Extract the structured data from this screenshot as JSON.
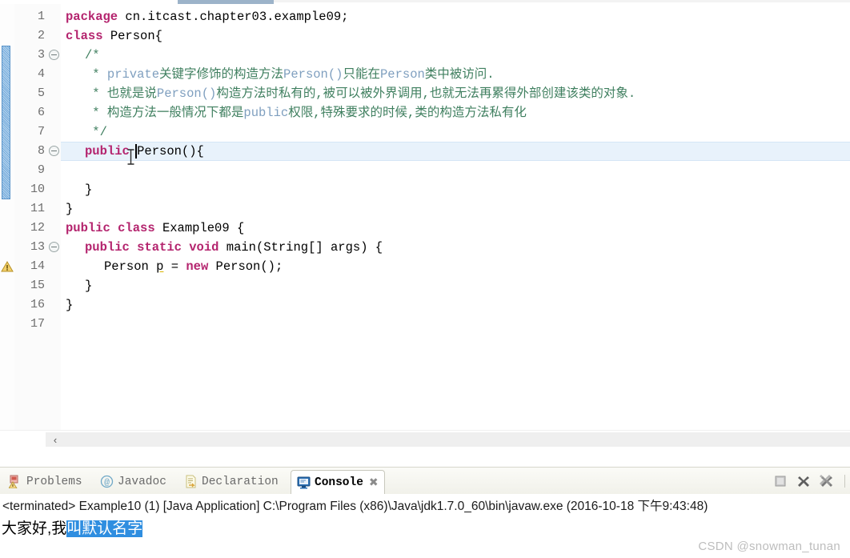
{
  "app": {
    "name": "Eclipse IDE",
    "watermark": "CSDN @snowman_tunan"
  },
  "editor": {
    "font": "monospace",
    "current_line": 8,
    "caret_line": 8,
    "caret_column": 16,
    "changed_lines_from": 3,
    "changed_lines_to": 10,
    "warning_line": 14,
    "folding_lines": [
      3,
      8,
      13
    ],
    "line_numbers": [
      "1",
      "2",
      "3",
      "4",
      "5",
      "6",
      "7",
      "8",
      "9",
      "10",
      "11",
      "12",
      "13",
      "14",
      "15",
      "16",
      "17"
    ],
    "lines": [
      {
        "n": "1",
        "indent": 0,
        "segments": [
          {
            "t": "kw",
            "s": "package"
          },
          {
            "t": "plain",
            "s": " cn.itcast.chapter03.example09;"
          }
        ]
      },
      {
        "n": "2",
        "indent": 0,
        "segments": [
          {
            "t": "kw",
            "s": "class"
          },
          {
            "t": "plain",
            "s": " Person{"
          }
        ]
      },
      {
        "n": "3",
        "indent": 1,
        "segments": [
          {
            "t": "cmt",
            "s": "/*"
          }
        ]
      },
      {
        "n": "4",
        "indent": 1,
        "segments": [
          {
            "t": "cmt",
            "s": " * "
          },
          {
            "t": "cmt-kw",
            "s": "private"
          },
          {
            "t": "cmt",
            "s": "关键字修饰的构造方法"
          },
          {
            "t": "cmt-kw",
            "s": "Person()"
          },
          {
            "t": "cmt",
            "s": "只能在"
          },
          {
            "t": "cmt-kw",
            "s": "Person"
          },
          {
            "t": "cmt",
            "s": "类中被访问."
          }
        ]
      },
      {
        "n": "5",
        "indent": 1,
        "segments": [
          {
            "t": "cmt",
            "s": " * 也就是说"
          },
          {
            "t": "cmt-kw",
            "s": "Person()"
          },
          {
            "t": "cmt",
            "s": "构造方法时私有的,被可以被外界调用,也就无法再累得外部创建该类的对象."
          }
        ]
      },
      {
        "n": "6",
        "indent": 1,
        "segments": [
          {
            "t": "cmt",
            "s": " * 构造方法一般情况下都是"
          },
          {
            "t": "cmt-kw",
            "s": "public"
          },
          {
            "t": "cmt",
            "s": "权限,特殊要求的时候,类的构造方法私有化"
          }
        ]
      },
      {
        "n": "7",
        "indent": 1,
        "segments": [
          {
            "t": "cmt",
            "s": " */"
          }
        ]
      },
      {
        "n": "8",
        "indent": 1,
        "segments": [
          {
            "t": "kw",
            "s": "public"
          },
          {
            "t": "plain",
            "s": " Person(){"
          }
        ]
      },
      {
        "n": "9",
        "indent": 1,
        "segments": [
          {
            "t": "plain",
            "s": ""
          }
        ]
      },
      {
        "n": "10",
        "indent": 1,
        "segments": [
          {
            "t": "plain",
            "s": "}"
          }
        ]
      },
      {
        "n": "11",
        "indent": 0,
        "segments": [
          {
            "t": "plain",
            "s": "}"
          }
        ]
      },
      {
        "n": "12",
        "indent": 0,
        "segments": [
          {
            "t": "kw",
            "s": "public"
          },
          {
            "t": "plain",
            "s": " "
          },
          {
            "t": "kw",
            "s": "class"
          },
          {
            "t": "plain",
            "s": " Example09 {"
          }
        ]
      },
      {
        "n": "13",
        "indent": 1,
        "segments": [
          {
            "t": "kw",
            "s": "public"
          },
          {
            "t": "plain",
            "s": " "
          },
          {
            "t": "kw",
            "s": "static"
          },
          {
            "t": "plain",
            "s": " "
          },
          {
            "t": "kw",
            "s": "void"
          },
          {
            "t": "plain",
            "s": " main(String[] args) {"
          }
        ]
      },
      {
        "n": "14",
        "indent": 2,
        "segments": [
          {
            "t": "plain",
            "s": "Person "
          },
          {
            "t": "warn",
            "s": "p"
          },
          {
            "t": "plain",
            "s": " = "
          },
          {
            "t": "kw",
            "s": "new"
          },
          {
            "t": "plain",
            "s": " Person();"
          }
        ]
      },
      {
        "n": "15",
        "indent": 1,
        "segments": [
          {
            "t": "plain",
            "s": "}"
          }
        ]
      },
      {
        "n": "16",
        "indent": 0,
        "segments": [
          {
            "t": "plain",
            "s": "}"
          }
        ]
      },
      {
        "n": "17",
        "indent": 0,
        "segments": [
          {
            "t": "plain",
            "s": ""
          }
        ]
      }
    ]
  },
  "scrollbar": {
    "left_arrow": "‹"
  },
  "bottom_view": {
    "tabs": [
      {
        "label": "Problems",
        "icon": "problems-icon",
        "active": false,
        "closable": false
      },
      {
        "label": "Javadoc",
        "icon": "javadoc-icon",
        "active": false,
        "closable": false
      },
      {
        "label": "Declaration",
        "icon": "declaration-icon",
        "active": false,
        "closable": false
      },
      {
        "label": "Console",
        "icon": "console-icon",
        "active": true,
        "closable": true,
        "close_glyph": "✖"
      }
    ],
    "tools": [
      {
        "name": "terminate-button",
        "title": "Terminate"
      },
      {
        "name": "remove-launch-button",
        "title": "Remove Launch"
      },
      {
        "name": "remove-all-terminated-button",
        "title": "Remove All Terminated Launches"
      }
    ],
    "console": {
      "header": "<terminated> Example10 (1) [Java Application] C:\\Program Files (x86)\\Java\\jdk1.7.0_60\\bin\\javaw.exe (2016-10-18 下午9:43:48)",
      "output_plain": "大家好,我",
      "output_selected": "叫默认名字"
    }
  },
  "colors": {
    "keyword": "#b4246e",
    "comment": "#3f7f5f",
    "comment_code": "#7f9fbf",
    "current_line": "#e8f2fb",
    "diff_bar": "#72a9db",
    "selection": "#2f8ee0",
    "warning": "#d9b300"
  }
}
